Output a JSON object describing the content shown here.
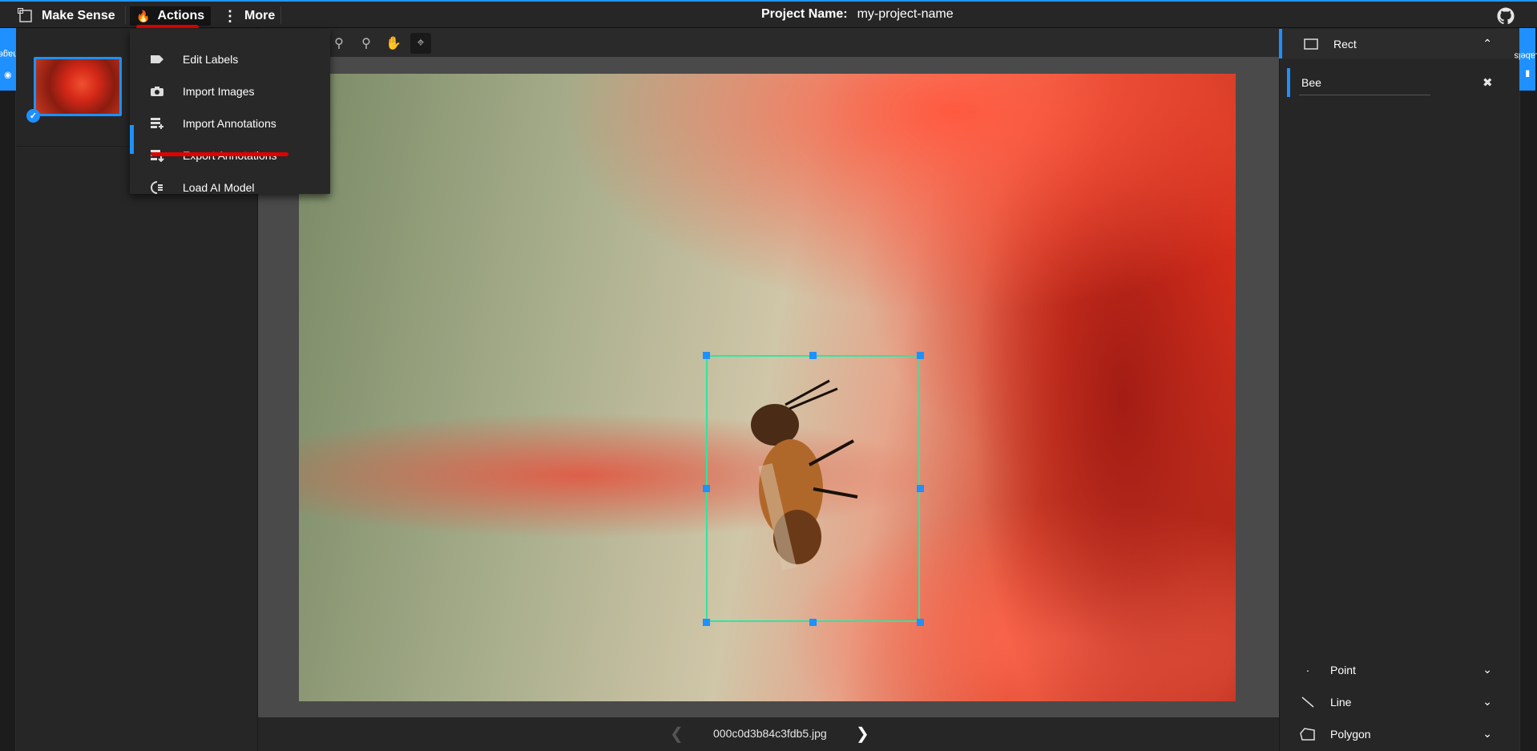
{
  "app": {
    "name": "Make Sense"
  },
  "nav": {
    "actions_label": "Actions",
    "more_label": "More"
  },
  "project": {
    "name_label": "Project Name:",
    "name_value": "my-project-name"
  },
  "side_tabs": {
    "images": "Images",
    "labels": "Labels"
  },
  "actions_menu": {
    "items": [
      {
        "label": "Edit Labels",
        "icon": "label-tag-icon"
      },
      {
        "label": "Import Images",
        "icon": "camera-icon"
      },
      {
        "label": "Import Annotations",
        "icon": "import-icon"
      },
      {
        "label": "Export Annotations",
        "icon": "export-icon"
      },
      {
        "label": "Load AI Model",
        "icon": "ai-model-icon"
      }
    ]
  },
  "toolbar": {
    "tools": [
      "zoom-in-icon",
      "zoom-out-icon",
      "hand-icon",
      "crosshair-icon"
    ]
  },
  "image": {
    "filename": "000c0d3b84c3fdb5.jpg"
  },
  "label_tools": {
    "rect": "Rect",
    "point": "Point",
    "line": "Line",
    "polygon": "Polygon"
  },
  "labels": [
    {
      "name": "Bee"
    }
  ],
  "colors": {
    "accent": "#1e90ff",
    "highlight": "#e00000",
    "bbox": "#2ee6a0"
  }
}
